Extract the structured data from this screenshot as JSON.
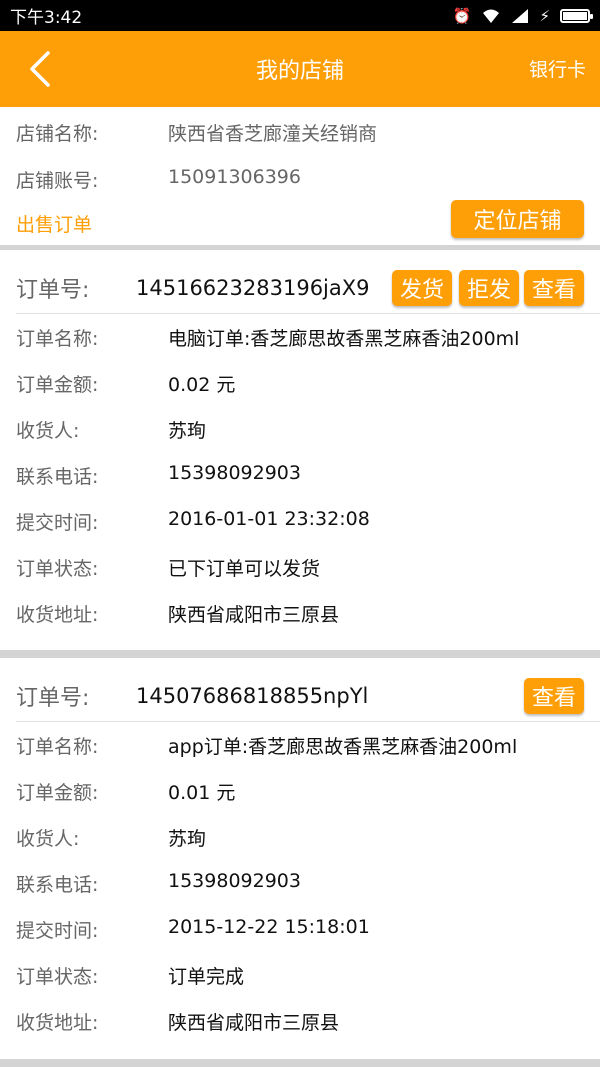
{
  "status": {
    "time": "下午3:42"
  },
  "nav": {
    "title": "我的店铺",
    "right": "银行卡"
  },
  "shop": {
    "name_label": "店铺名称:",
    "name_value": "陕西省香芝廊潼关经销商",
    "account_label": "店铺账号:",
    "account_value": "15091306396",
    "sale_orders": "出售订单",
    "locate_button": "定位店铺"
  },
  "labels": {
    "order_no": "订单号:",
    "order_name": "订单名称:",
    "amount": "订单金额:",
    "receiver": "收货人:",
    "phone": "联系电话:",
    "time": "提交时间:",
    "status": "订单状态:",
    "address": "收货地址:"
  },
  "orders": [
    {
      "order_no": "14516623283196jaX9",
      "name": "电脑订单:香芝廊思故香黑芝麻香油200ml",
      "amount": "0.02 元",
      "receiver": "苏珣",
      "phone": "15398092903",
      "time": "2016-01-01 23:32:08",
      "status": "已下订单可以发货",
      "address": "陕西省咸阳市三原县",
      "buttons": {
        "ship": "发货",
        "reject": "拒发",
        "view": "查看"
      }
    },
    {
      "order_no": "14507686818855npYl",
      "name": "app订单:香芝廊思故香黑芝麻香油200ml",
      "amount": "0.01 元",
      "receiver": "苏珣",
      "phone": "15398092903",
      "time": "2015-12-22 15:18:01",
      "status": "订单完成",
      "address": "陕西省咸阳市三原县",
      "buttons": {
        "view": "查看"
      }
    }
  ],
  "colors": {
    "accent": "#FF9F08"
  }
}
